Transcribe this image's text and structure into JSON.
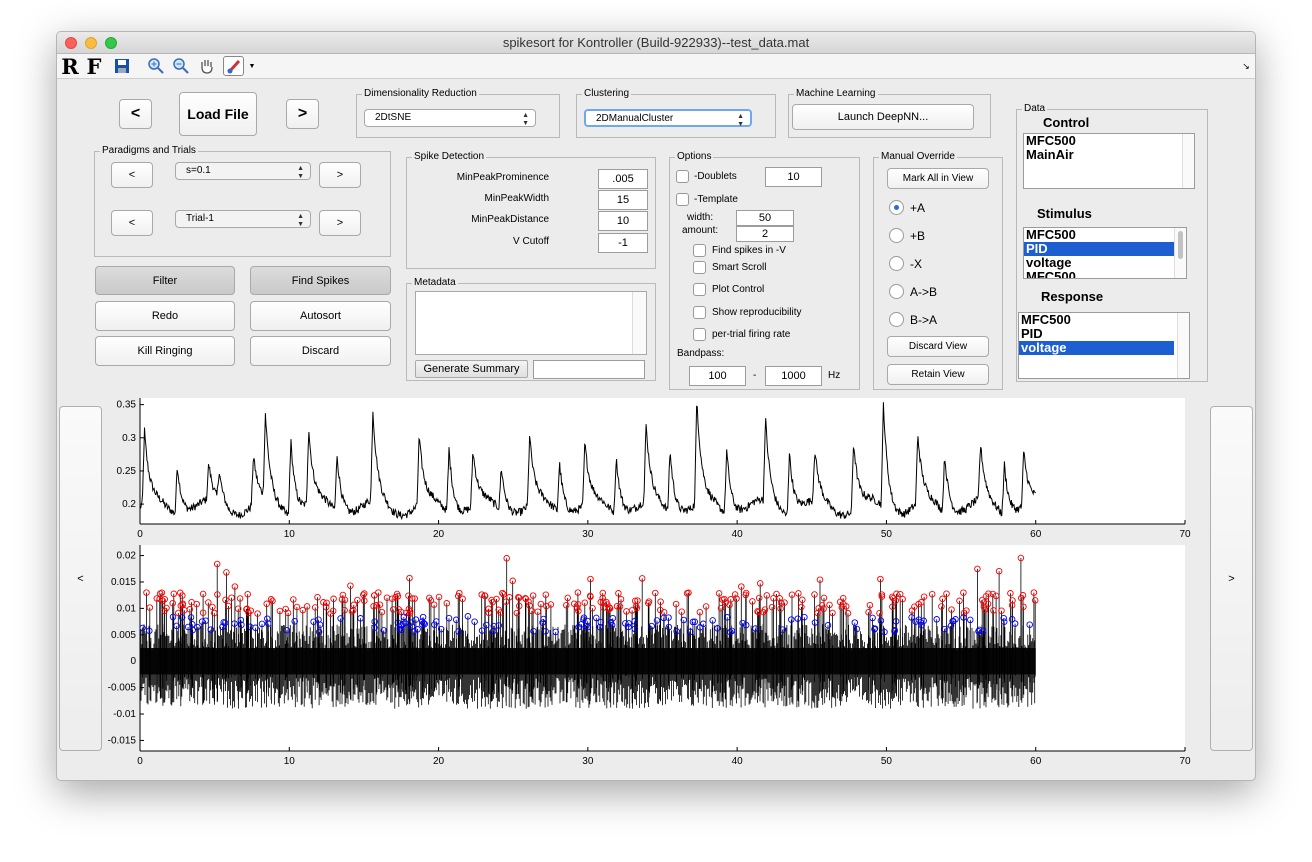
{
  "window": {
    "title": "spikesort for Kontroller (Build-922933)--test_data.mat"
  },
  "toolbar": {
    "r_label": "R",
    "f_label": "F",
    "icons": [
      "save-icon",
      "zoom-in-icon",
      "zoom-out-icon",
      "pan-icon",
      "brush-icon"
    ]
  },
  "nav": {
    "prev": "<",
    "load": "Load File",
    "next": ">"
  },
  "dimred": {
    "title": "Dimensionality Reduction",
    "value": "2DtSNE"
  },
  "clustering": {
    "title": "Clustering",
    "value": "2DManualCluster"
  },
  "ml": {
    "title": "Machine Learning",
    "button": "Launch DeepNN..."
  },
  "paradigms": {
    "title": "Paradigms and Trials",
    "prev1": "<",
    "paradigm": "s=0.1",
    "next1": ">",
    "prev2": "<",
    "trial": "Trial-1",
    "next2": ">"
  },
  "actions": {
    "filter": "Filter",
    "find_spikes": "Find Spikes",
    "redo": "Redo",
    "autosort": "Autosort",
    "kill_ringing": "Kill Ringing",
    "discard": "Discard"
  },
  "spike_detection": {
    "title": "Spike Detection",
    "rows": [
      {
        "label": "MinPeakProminence",
        "value": ".005"
      },
      {
        "label": "MinPeakWidth",
        "value": "15"
      },
      {
        "label": "MinPeakDistance",
        "value": "10"
      },
      {
        "label": "V Cutoff",
        "value": "-1"
      }
    ]
  },
  "metadata": {
    "title": "Metadata",
    "summary_button": "Generate Summary",
    "summary_value": ""
  },
  "options": {
    "title": "Options",
    "doublets": "-Doublets",
    "doublets_value": "10",
    "template": "-Template",
    "width_label": "width:",
    "width_value": "50",
    "amount_label": "amount:",
    "amount_value": "2",
    "find_neg": "Find spikes in -V",
    "smart_scroll": "Smart Scroll",
    "plot_control": "Plot Control",
    "show_repro": "Show reproducibility",
    "per_trial": "per-trial firing rate",
    "bandpass_label": "Bandpass:",
    "bp_low": "100",
    "bp_dash": "-",
    "bp_high": "1000",
    "bp_unit": "Hz"
  },
  "manual": {
    "title": "Manual Override",
    "mark_all": "Mark All in View",
    "radios": [
      "+A",
      "+B",
      "-X",
      "A->B",
      "B->A"
    ],
    "selected": 0,
    "discard_view": "Discard View",
    "retain_view": "Retain View"
  },
  "data_panel": {
    "title": "Data",
    "control_label": "Control",
    "control_items": [
      "MFC500",
      "MainAir"
    ],
    "stimulus_label": "Stimulus",
    "stimulus_items": [
      "MFC500",
      "PID",
      "voltage",
      "MFC500"
    ],
    "stimulus_selected": 1,
    "response_label": "Response",
    "response_items": [
      "MFC500",
      "PID",
      "voltage"
    ],
    "response_selected": 2
  },
  "side": {
    "left": "<",
    "right": ">"
  },
  "chart_data": [
    {
      "type": "line",
      "title": "",
      "xlim": [
        0,
        70
      ],
      "ylim": [
        0.17,
        0.36
      ],
      "xticks": [
        "0",
        "10",
        "20",
        "30",
        "40",
        "50",
        "60",
        "70"
      ],
      "yticks": [
        "0.2",
        "0.25",
        "0.3",
        "0.35"
      ],
      "series": [
        {
          "color": "#000000",
          "x_range": [
            0,
            60
          ]
        }
      ],
      "peaks_x": [
        0.3,
        2.5,
        4.6,
        5.3,
        7.6,
        8.4,
        10.1,
        11.3,
        13.2,
        15.6,
        18.7,
        20.7,
        22.3,
        24.2,
        26.1,
        28.1,
        29.8,
        31.9,
        33.9,
        35.5,
        37.3,
        39.3,
        41.9,
        43.5,
        45.2,
        47.8,
        49.8,
        52.1,
        53.9,
        56.3,
        57.9,
        59.2
      ],
      "peaks_y": [
        0.305,
        0.27,
        0.25,
        0.24,
        0.27,
        0.32,
        0.31,
        0.31,
        0.28,
        0.33,
        0.3,
        0.29,
        0.28,
        0.26,
        0.3,
        0.27,
        0.29,
        0.28,
        0.31,
        0.29,
        0.355,
        0.29,
        0.32,
        0.29,
        0.27,
        0.3,
        0.35,
        0.3,
        0.28,
        0.28,
        0.27,
        0.28
      ]
    },
    {
      "type": "line",
      "title": "",
      "xlim": [
        0,
        70
      ],
      "ylim": [
        -0.017,
        0.022
      ],
      "xticks": [
        "0",
        "10",
        "20",
        "30",
        "40",
        "50",
        "60",
        "70"
      ],
      "yticks": [
        "-0.015",
        "-0.01",
        "-0.005",
        "0",
        "0.005",
        "0.01",
        "0.015",
        "0.02"
      ],
      "series": [
        {
          "name": "A spikes",
          "color": "#ff0000",
          "marker": "circle",
          "y_typical": 0.011
        },
        {
          "name": "B spikes",
          "color": "#0000ff",
          "marker": "circle",
          "y_typical": 0.007
        },
        {
          "name": "voltage",
          "color": "#000000",
          "x_range": [
            0,
            60
          ]
        }
      ]
    }
  ]
}
